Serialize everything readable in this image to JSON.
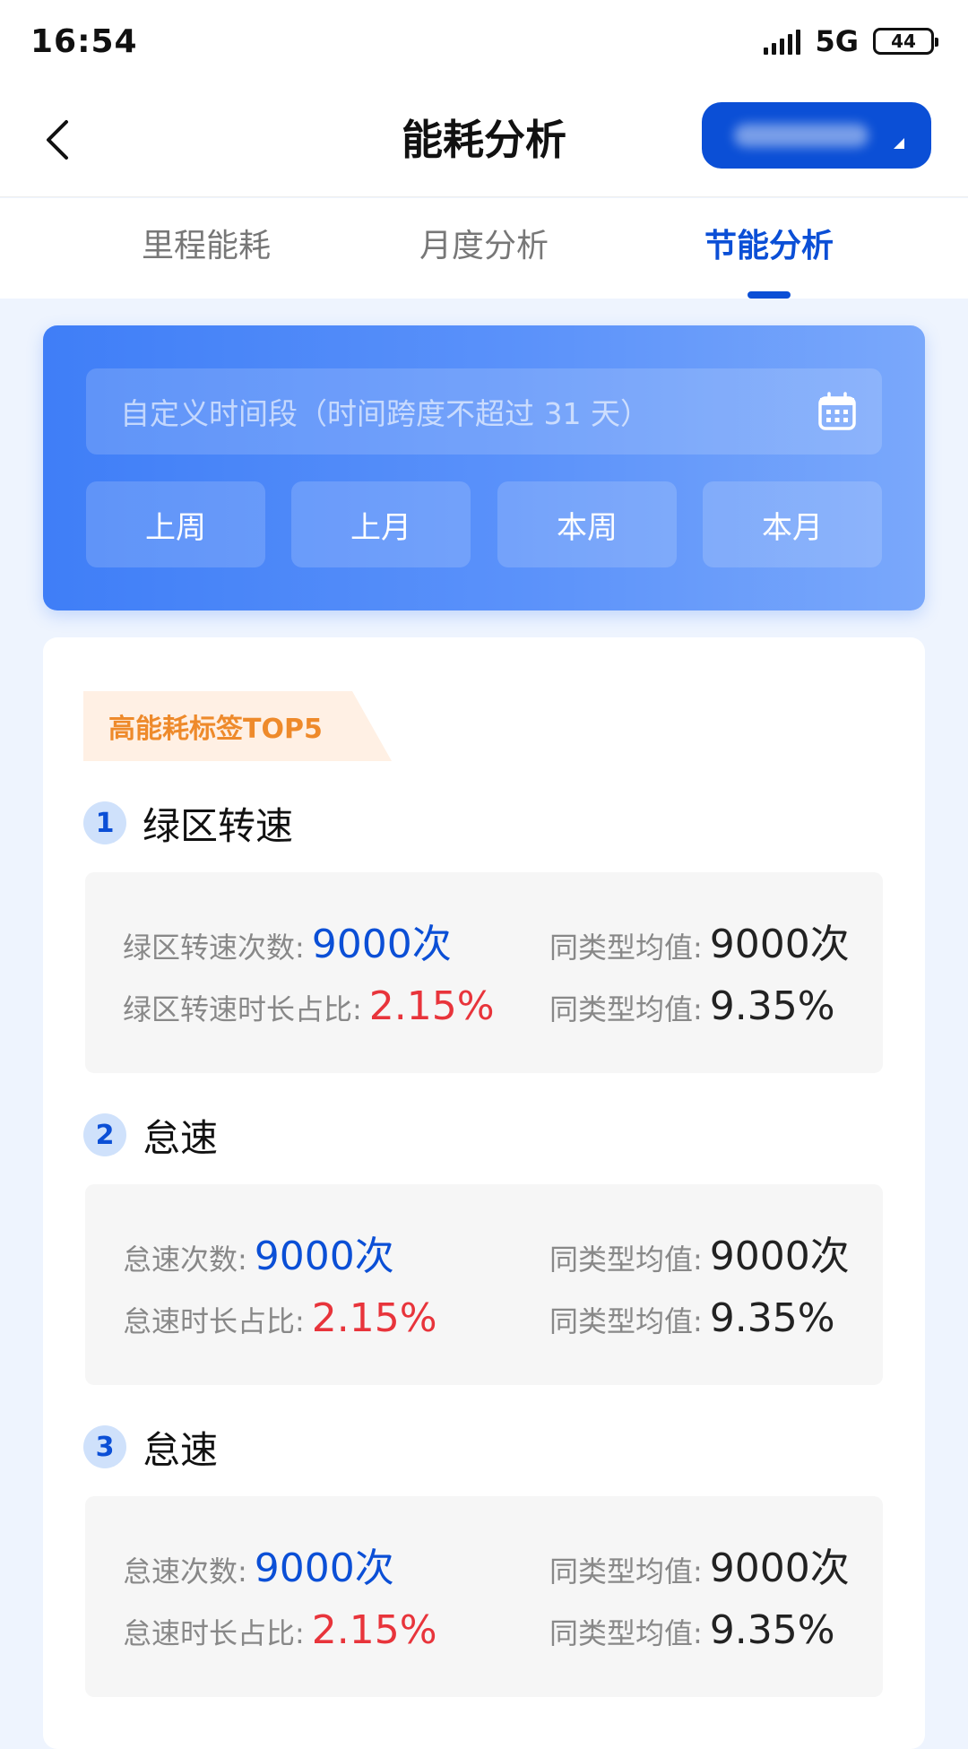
{
  "status_bar": {
    "time": "16:54",
    "network": "5G",
    "battery": "44"
  },
  "header": {
    "title": "能耗分析",
    "vehicle_select_value": ""
  },
  "tabs": [
    {
      "label": "里程能耗",
      "active": false
    },
    {
      "label": "月度分析",
      "active": false
    },
    {
      "label": "节能分析",
      "active": true
    }
  ],
  "filter": {
    "date_range_placeholder": "自定义时间段（时间跨度不超过 31 天）",
    "quick_buttons": [
      "上周",
      "上月",
      "本周",
      "本月"
    ]
  },
  "ranking": {
    "tag": "高能耗标签TOP5",
    "items": [
      {
        "rank": "1",
        "title": "绿区转速",
        "count_label": "绿区转速次数:",
        "count_value": "9000次",
        "count_avg_label": "同类型均值:",
        "count_avg_value": "9000次",
        "ratio_label": "绿区转速时长占比:",
        "ratio_value": "2.15%",
        "ratio_avg_label": "同类型均值:",
        "ratio_avg_value": "9.35%"
      },
      {
        "rank": "2",
        "title": "怠速",
        "count_label": "怠速次数:",
        "count_value": "9000次",
        "count_avg_label": "同类型均值:",
        "count_avg_value": "9000次",
        "ratio_label": "怠速时长占比:",
        "ratio_value": "2.15%",
        "ratio_avg_label": "同类型均值:",
        "ratio_avg_value": "9.35%"
      },
      {
        "rank": "3",
        "title": "怠速",
        "count_label": "怠速次数:",
        "count_value": "9000次",
        "count_avg_label": "同类型均值:",
        "count_avg_value": "9000次",
        "ratio_label": "怠速时长占比:",
        "ratio_value": "2.15%",
        "ratio_avg_label": "同类型均值:",
        "ratio_avg_value": "9.35%"
      }
    ]
  },
  "colors": {
    "primary": "#0b4fd6",
    "highlight_red": "#e8343b",
    "tag_orange": "#ee8a2b"
  }
}
